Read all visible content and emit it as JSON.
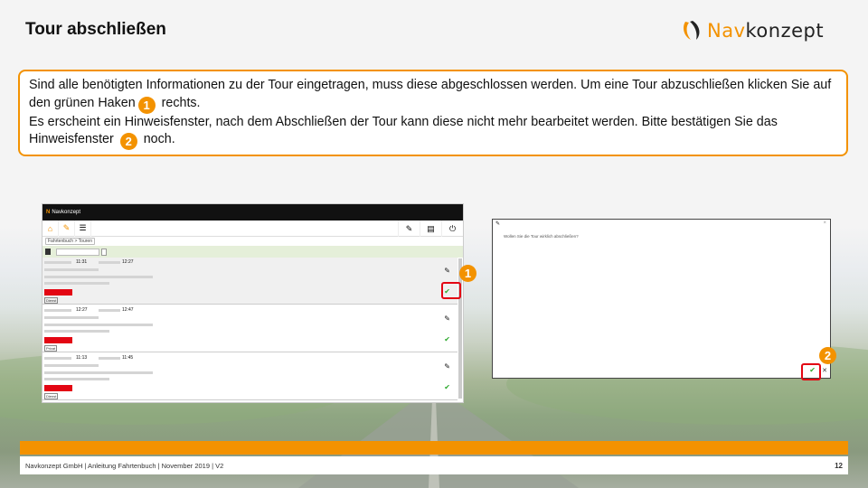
{
  "slide": {
    "title": "Tour abschließen",
    "logo_prefix": "Nav",
    "logo_suffix": "konzept"
  },
  "info": {
    "line1": "Sind alle benötigten Informationen zu der Tour eingetragen, muss diese abgeschlossen werden. Um eine Tour abzuschließen klicken Sie auf den grünen Haken",
    "badge1": "1",
    "line1_end": " rechts.",
    "line2": "Es erscheint ein Hinweisfenster, nach dem Abschließen der Tour kann diese nicht mehr bearbeitet werden. Bitte bestätigen Sie das Hinweisfenster",
    "badge2": "2",
    "line2_end": " noch."
  },
  "app": {
    "title_logo": "N",
    "title": "Navkonzept",
    "breadcrumb": "Fahrtenbuch > Touren",
    "filter_label": "Datum",
    "tours": [
      {
        "start": "11:31",
        "end": "12:27",
        "tag": "Dienst"
      },
      {
        "start": "12:27",
        "end": "12:47",
        "tag": "Privat"
      },
      {
        "start": "11:13",
        "end": "11:45",
        "tag": "Dienst"
      }
    ]
  },
  "dialog": {
    "message": "Wollen Sie die Tour wirklich abschließen?"
  },
  "markers": {
    "m1": "1",
    "m2": "2"
  },
  "footer": {
    "text": "Navkonzept GmbH  |  Anleitung Fahrtenbuch  |  November 2019  |  V2",
    "page": "12"
  },
  "colors": {
    "accent": "#f39200",
    "red": "#e30613",
    "green": "#2eaa2e"
  }
}
